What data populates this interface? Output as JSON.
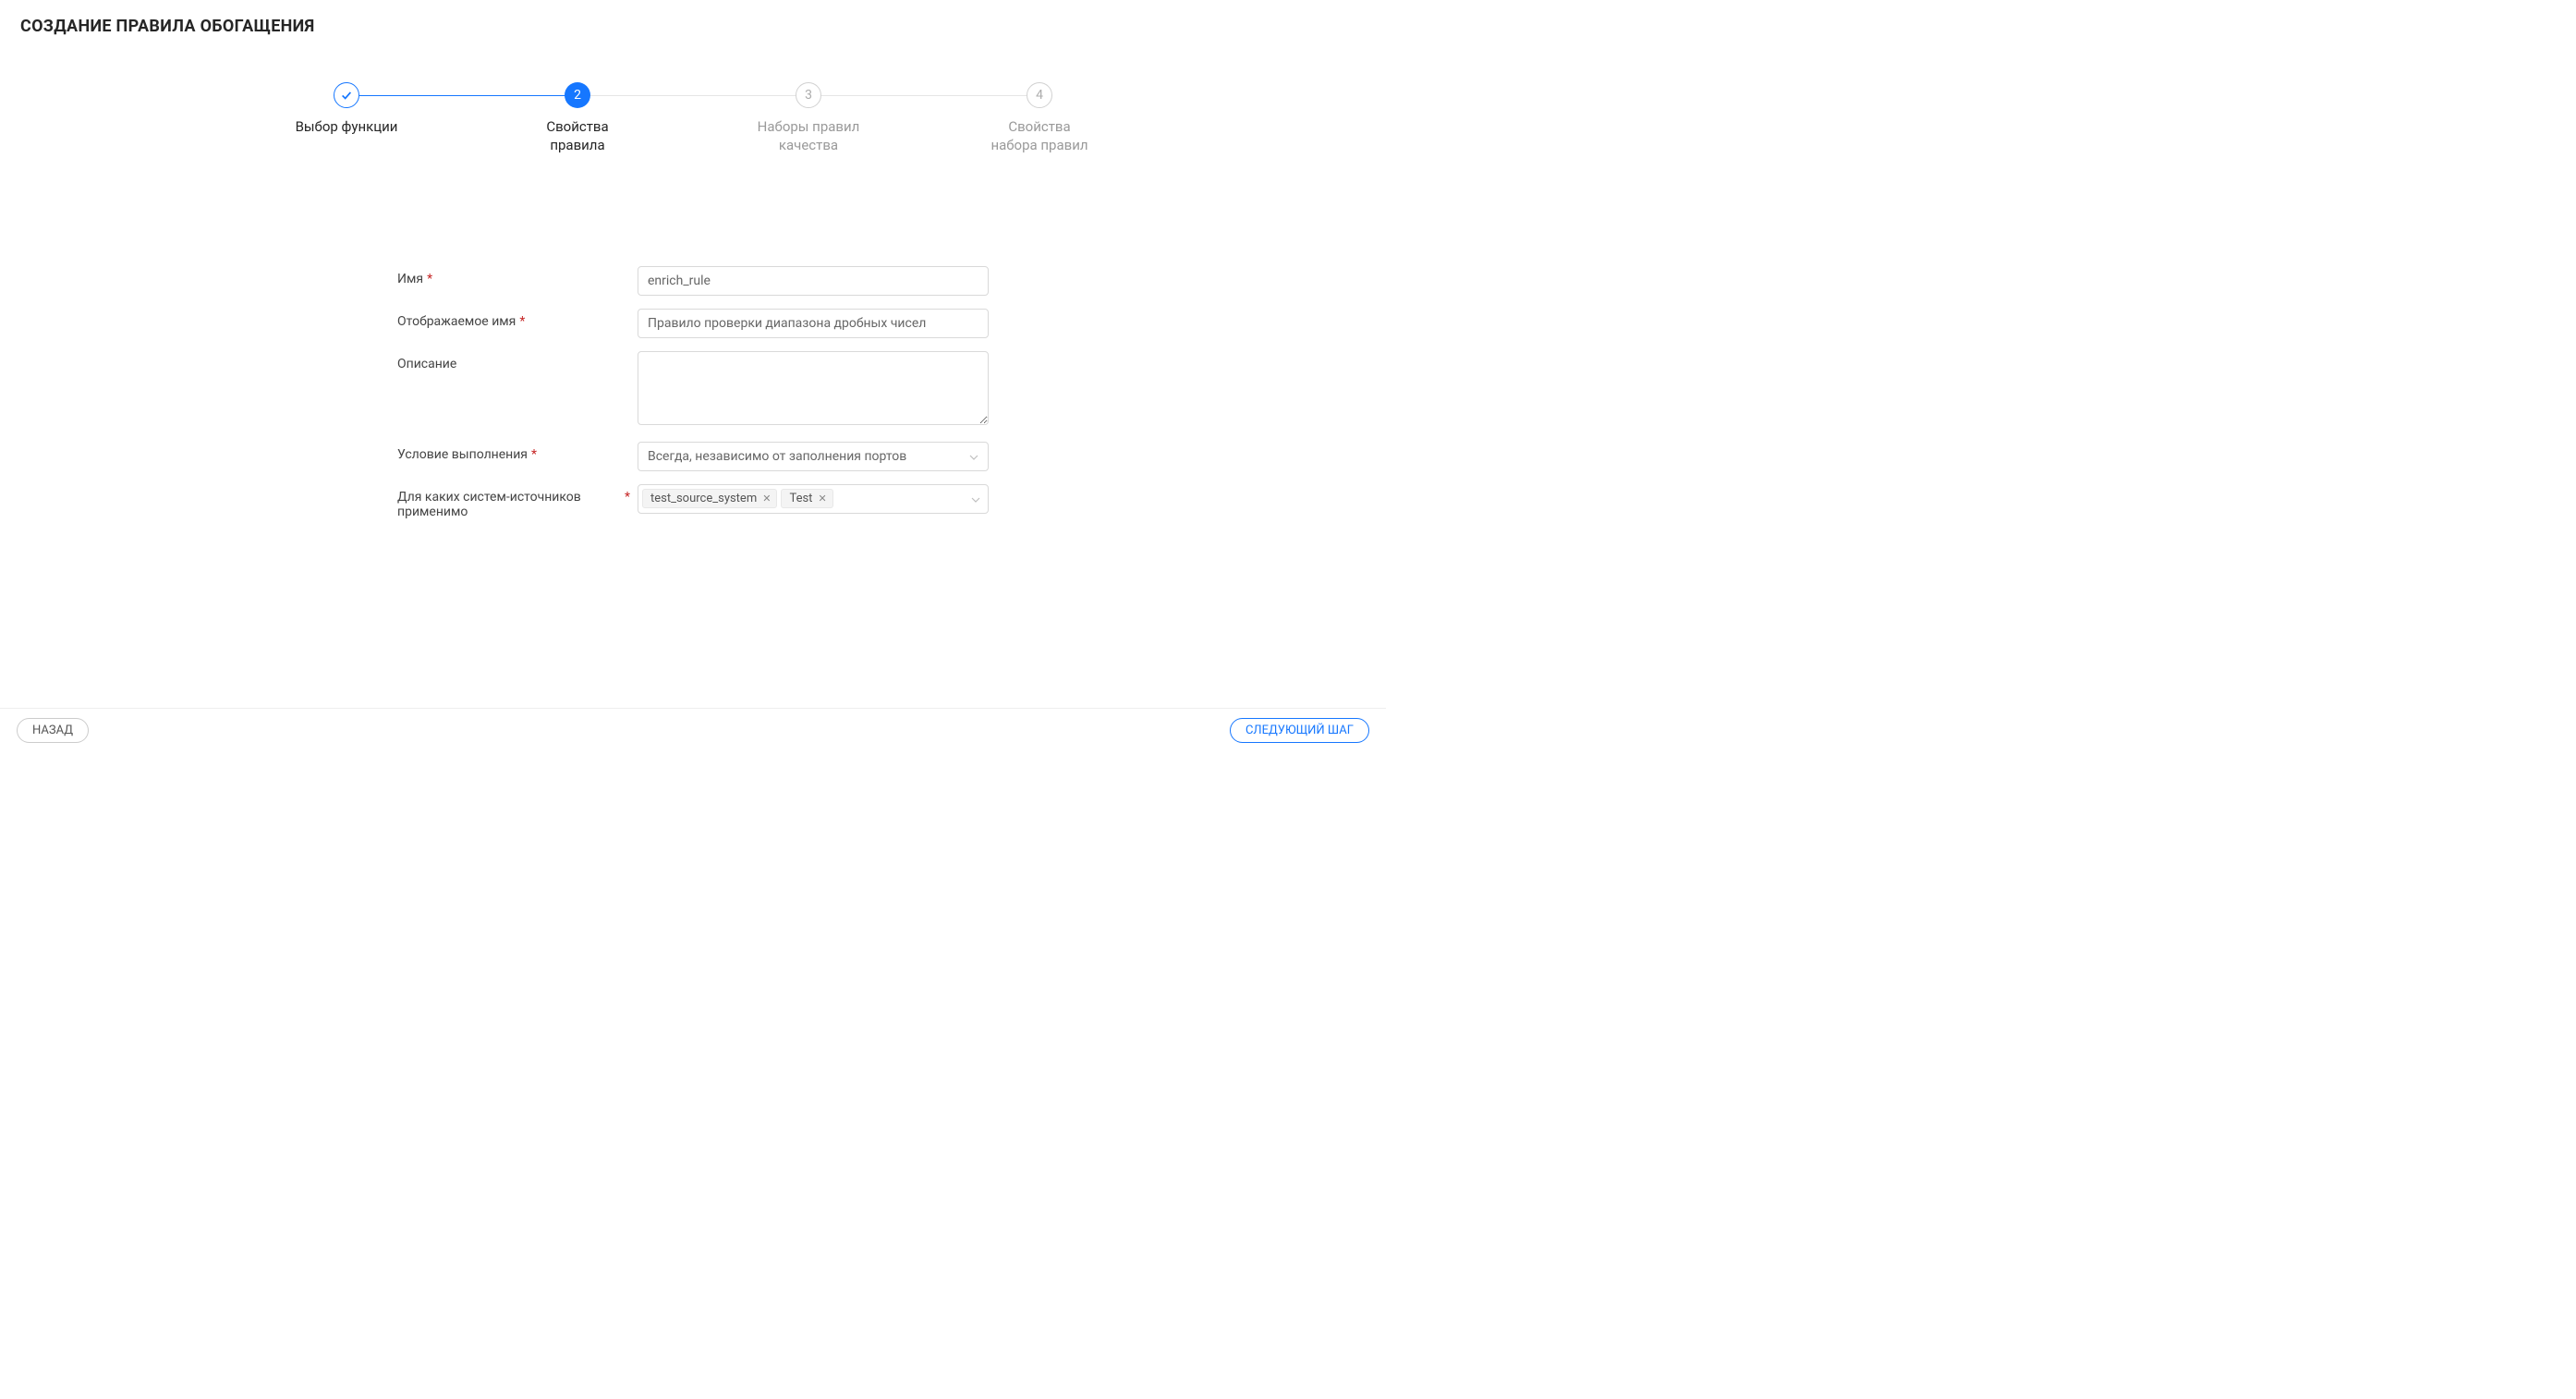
{
  "page": {
    "title": "СОЗДАНИЕ ПРАВИЛА ОБОГАЩЕНИЯ"
  },
  "stepper": {
    "steps": [
      {
        "label": "Выбор функции",
        "number": "1",
        "state": "completed"
      },
      {
        "label": "Свойства\nправила",
        "number": "2",
        "state": "current"
      },
      {
        "label": "Наборы правил\nкачества",
        "number": "3",
        "state": "pending"
      },
      {
        "label": "Свойства\nнабора правил",
        "number": "4",
        "state": "pending"
      }
    ]
  },
  "form": {
    "name": {
      "label": "Имя",
      "value": "enrich_rule",
      "required": true
    },
    "display_name": {
      "label": "Отображаемое имя",
      "value": "Правило проверки диапазона дробных чисел",
      "required": true
    },
    "description": {
      "label": "Описание",
      "value": "",
      "required": false
    },
    "condition": {
      "label": "Условие выполнения",
      "value": "Всегда, независимо от заполнения портов",
      "required": true
    },
    "sources": {
      "label": "Для каких систем-источников применимо",
      "required": true,
      "tags": [
        "test_source_system",
        "Test"
      ]
    }
  },
  "footer": {
    "back": "НАЗАД",
    "next": "СЛЕДУЮЩИЙ ШАГ"
  }
}
